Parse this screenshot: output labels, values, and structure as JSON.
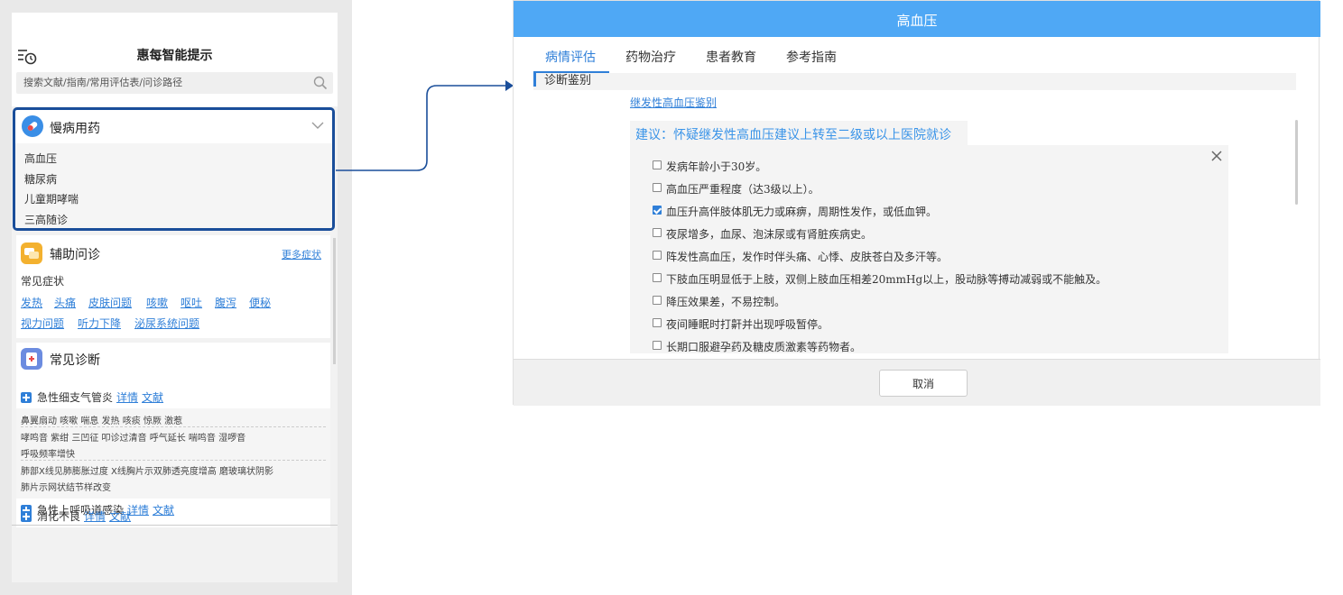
{
  "phone": {
    "title": "惠每智能提示",
    "search": {
      "placeholder": "搜索文献/指南/常用评估表/问诊路径"
    },
    "chronic": {
      "title": "慢病用药",
      "items": [
        {
          "label": "高血压"
        },
        {
          "label": "糖尿病"
        },
        {
          "label": "儿童期哮喘"
        },
        {
          "label": "三高随诊"
        }
      ]
    },
    "assist": {
      "title": "辅助问诊",
      "more": "更多症状",
      "symptoms_label": "常见症状",
      "symptoms": [
        {
          "label": "发热"
        },
        {
          "label": "头痛"
        },
        {
          "label": "皮肤问题"
        },
        {
          "label": "咳嗽"
        },
        {
          "label": "呕吐"
        },
        {
          "label": "腹泻"
        },
        {
          "label": "便秘"
        },
        {
          "label": "视力问题"
        },
        {
          "label": "听力下降"
        },
        {
          "label": "泌尿系统问题"
        }
      ]
    },
    "diagnosis": {
      "title": "常见诊断",
      "detail_label": "详情",
      "ref_label": "文献",
      "items": [
        {
          "name": "急性细支气管炎"
        },
        {
          "name": "急性上呼吸道感染"
        },
        {
          "name": "消化不良"
        }
      ],
      "details": [
        "鼻翼扇动  咳嗽  喘息  发热  咳痰  惊厥  激惹",
        "哮鸣音  紫绀  三凹征  叩诊过清音  呼气延长  喘鸣音  湿啰音",
        "呼吸频率增快",
        "肺部X线见肺膨胀过度  X线胸片示双肺透亮度增高  磨玻璃状阴影",
        "肺片示网状结节样改变"
      ]
    }
  },
  "dialog": {
    "title": "高血压",
    "tabs": [
      {
        "label": "病情评估"
      },
      {
        "label": "药物治疗"
      },
      {
        "label": "患者教育"
      },
      {
        "label": "参考指南"
      }
    ],
    "section_title": "诊断鉴别",
    "secondary_link": "继发性高血压鉴别",
    "suggestion": "建议：怀疑继发性高血压建议上转至二级或以上医院就诊",
    "checks": [
      {
        "label": "发病年龄小于30岁。",
        "checked": false
      },
      {
        "label": "高血压严重程度（达3级以上）。",
        "checked": false
      },
      {
        "label": "血压升高伴肢体肌无力或麻痹，周期性发作，或低血钾。",
        "checked": true
      },
      {
        "label": "夜尿增多，血尿、泡沫尿或有肾脏疾病史。",
        "checked": false
      },
      {
        "label": "阵发性高血压，发作时伴头痛、心悸、皮肤苍白及多汗等。",
        "checked": false
      },
      {
        "label": "下肢血压明显低于上肢，双侧上肢血压相差20mmHg以上，股动脉等搏动减弱或不能触及。",
        "checked": false
      },
      {
        "label": "降压效果差，不易控制。",
        "checked": false
      },
      {
        "label": "夜间睡眠时打鼾并出现呼吸暂停。",
        "checked": false
      },
      {
        "label": "长期口服避孕药及糖皮质激素等药物者。",
        "checked": false
      }
    ],
    "cancel_label": "取消"
  },
  "colors": {
    "accent": "#2f7fd8",
    "header_blue": "#4fa8f5",
    "highlight_border": "#1a4e9a"
  },
  "icons": [
    "history-icon",
    "search-icon",
    "chevron-down-icon",
    "pill-icon",
    "chat-icon",
    "diagnosis-icon",
    "plus-icon",
    "close-icon"
  ]
}
